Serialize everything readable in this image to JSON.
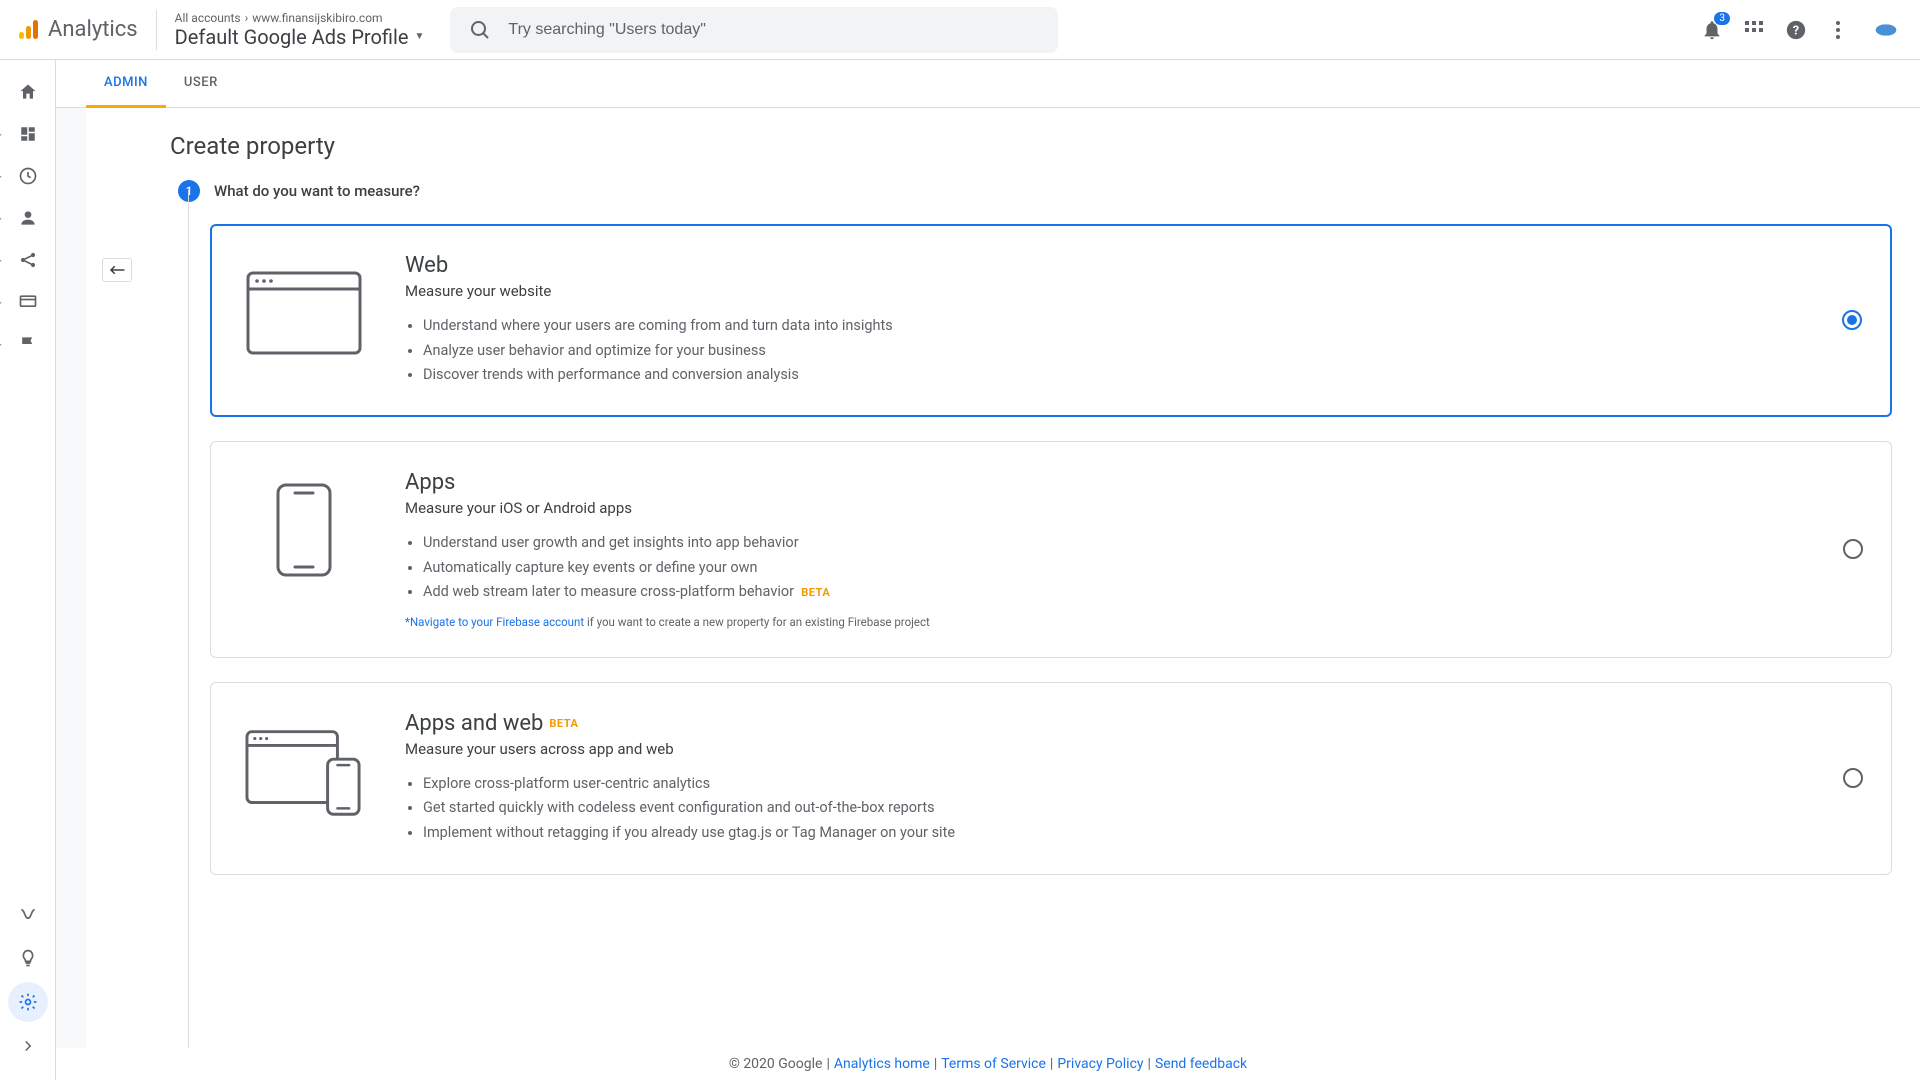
{
  "header": {
    "product": "Analytics",
    "breadcrumb_all": "All accounts",
    "breadcrumb_site": "www.finansijskibiro.com",
    "profile": "Default Google Ads Profile",
    "search_placeholder": "Try searching \"Users today\"",
    "notif_count": "3"
  },
  "tabs": {
    "admin": "ADMIN",
    "user": "USER"
  },
  "page": {
    "title": "Create property",
    "step_num": "1",
    "step_label": "What do you want to measure?"
  },
  "cards": {
    "web": {
      "title": "Web",
      "subtitle": "Measure your website",
      "b1": "Understand where your users are coming from and turn data into insights",
      "b2": "Analyze user behavior and optimize for your business",
      "b3": "Discover trends with performance and conversion analysis"
    },
    "apps": {
      "title": "Apps",
      "subtitle": "Measure your iOS or Android apps",
      "b1": "Understand user growth and get insights into app behavior",
      "b2": "Automatically capture key events or define your own",
      "b3": "Add web stream later to measure cross-platform behavior",
      "beta": "BETA",
      "note_link": "*Navigate to your Firebase account",
      "note_rest": " if you want to create a new property for an existing Firebase project"
    },
    "both": {
      "title": "Apps and web",
      "beta": "BETA",
      "subtitle": "Measure your users across app and web",
      "b1": "Explore cross-platform user-centric analytics",
      "b2": "Get started quickly with codeless event configuration and out-of-the-box reports",
      "b3": "Implement without retagging if you already use gtag.js or Tag Manager on your site"
    }
  },
  "footer": {
    "copyright": "© 2020 Google",
    "home": "Analytics home",
    "tos": "Terms of Service",
    "privacy": "Privacy Policy",
    "feedback": "Send feedback"
  }
}
